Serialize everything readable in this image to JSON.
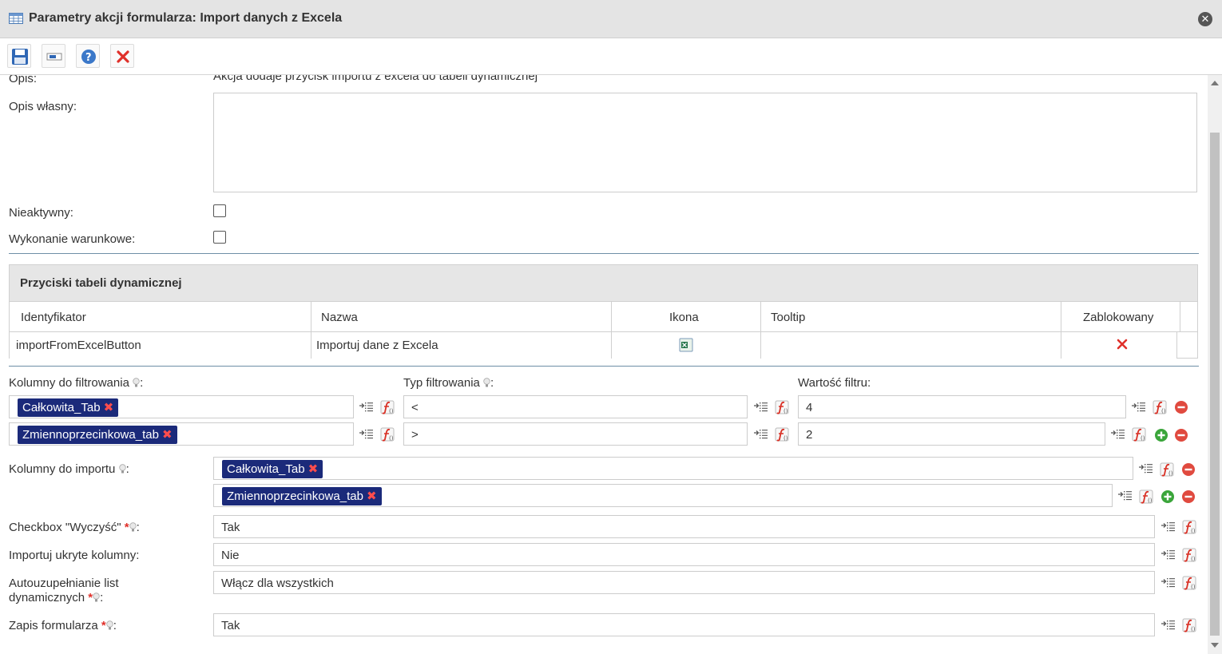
{
  "window": {
    "title": "Parametry akcji formularza: Import danych z Excela"
  },
  "toolbar": {
    "save": "save-icon",
    "field": "field-icon",
    "help": "help-icon",
    "cancel": "cancel-icon"
  },
  "form": {
    "opis_label": "Opis:",
    "opis_value": "Akcja dodaje przycisk importu z excela do tabeli dynamicznej",
    "opis_wlasny_label": "Opis własny:",
    "opis_wlasny_value": "",
    "nieaktywny_label": "Nieaktywny:",
    "nieaktywny_checked": false,
    "warunkowe_label": "Wykonanie warunkowe:",
    "warunkowe_checked": false
  },
  "buttons_table": {
    "title": "Przyciski tabeli dynamicznej",
    "columns": [
      "Identyfikator",
      "Nazwa",
      "Ikona",
      "Tooltip",
      "Zablokowany"
    ],
    "rows": [
      {
        "id": "importFromExcelButton",
        "name": "Importuj dane z Excela",
        "icon": "excel-icon",
        "tooltip": "",
        "locked": "delete-icon"
      }
    ]
  },
  "filters": {
    "col_label": "Kolumny do filtrowania",
    "type_label": "Typ filtrowania",
    "value_label": "Wartość filtru:",
    "colon": ":",
    "rows": [
      {
        "column": "Całkowita_Tab",
        "type": "<",
        "value": "4"
      },
      {
        "column": "Zmiennoprzecinkowa_tab",
        "type": ">",
        "value": "2"
      }
    ]
  },
  "import": {
    "label": "Kolumny do importu",
    "colon": ":",
    "rows": [
      "Całkowita_Tab",
      "Zmiennoprzecinkowa_tab"
    ]
  },
  "settings": [
    {
      "label": "Checkbox \"Wyczyść\"",
      "required": true,
      "value": "Tak"
    },
    {
      "label": "Importuj ukryte kolumny:",
      "required": false,
      "value": "Nie"
    },
    {
      "label_line1": "Autouzupełnianie list",
      "label_line2": "dynamicznych",
      "required": true,
      "value": "Włącz dla wszystkich"
    },
    {
      "label": "Zapis formularza",
      "required": true,
      "value": "Tak"
    }
  ],
  "colors": {
    "tag_bg": "#1b2a7a",
    "accent_line": "#6e8fa6",
    "remove_red": "#e0302a",
    "add_green": "#3aa53a"
  }
}
